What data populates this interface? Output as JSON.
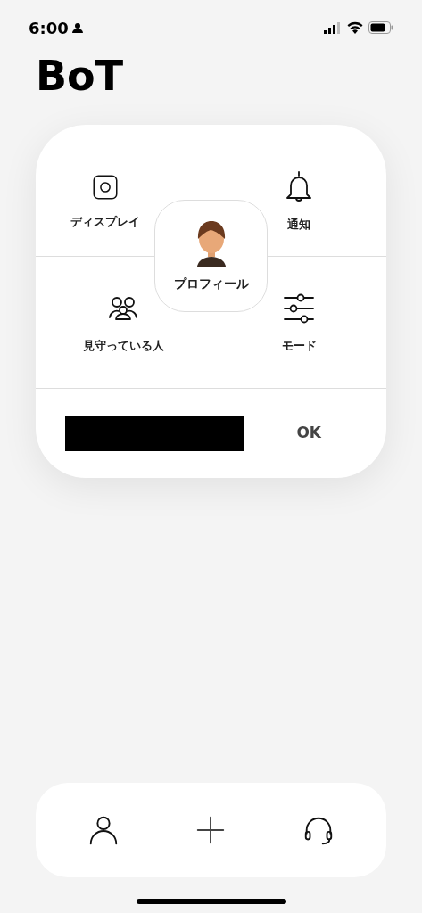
{
  "status_bar": {
    "time": "6:00"
  },
  "title": "BoT",
  "menu": {
    "tiles": [
      {
        "kind": "display",
        "label": "ディスプレイ"
      },
      {
        "kind": "bell",
        "label": "通知"
      },
      {
        "kind": "people",
        "label": "見守っている人"
      },
      {
        "kind": "sliders",
        "label": "モード"
      }
    ],
    "profile": {
      "label": "プロフィール"
    },
    "ok_button": "OK"
  },
  "bottom_nav": [
    {
      "kind": "person"
    },
    {
      "kind": "plus"
    },
    {
      "kind": "headset"
    }
  ]
}
